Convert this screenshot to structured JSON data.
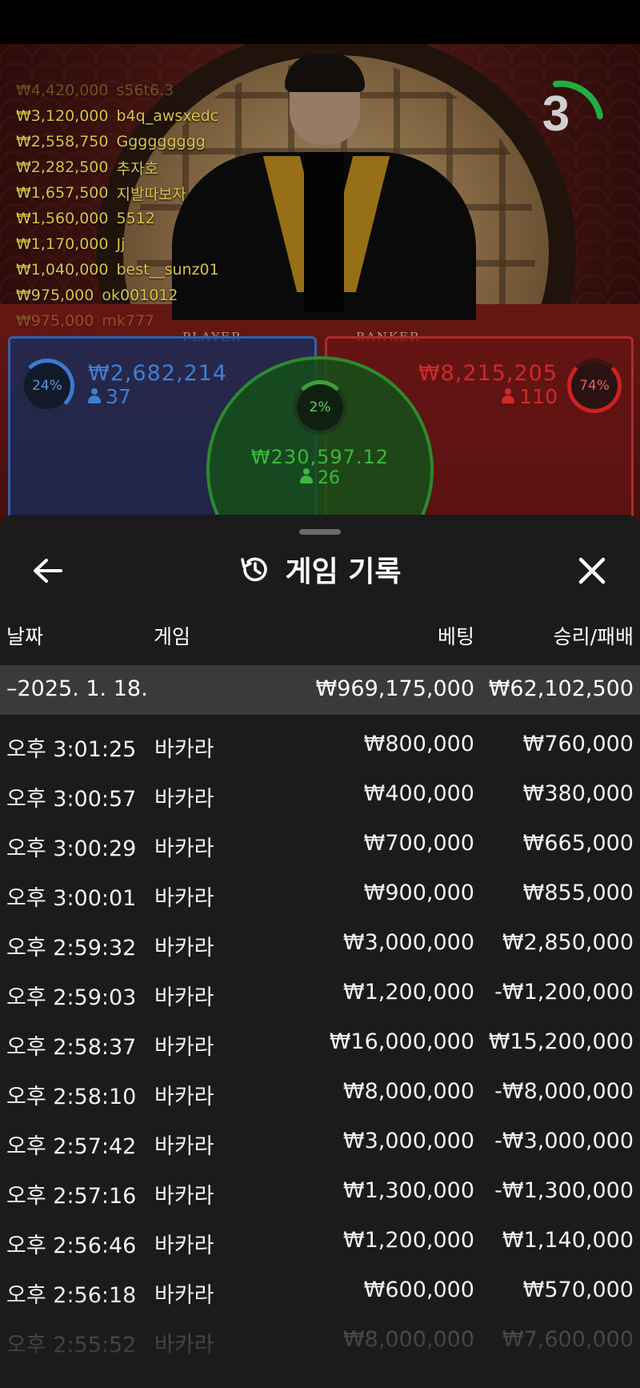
{
  "live": {
    "leaderboard": [
      {
        "amount": "₩4,420,000",
        "name": "s56t6.3",
        "faded": "top"
      },
      {
        "amount": "₩3,120,000",
        "name": "b4q_awsxedc"
      },
      {
        "amount": "₩2,558,750",
        "name": "Ggggggggg"
      },
      {
        "amount": "₩2,282,500",
        "name": "추자호"
      },
      {
        "amount": "₩1,657,500",
        "name": "지발따보자"
      },
      {
        "amount": "₩1,560,000",
        "name": "5512"
      },
      {
        "amount": "₩1,170,000",
        "name": "Jj"
      },
      {
        "amount": "₩1,040,000",
        "name": "best__sunz01"
      },
      {
        "amount": "₩975,000",
        "name": "ok001012"
      },
      {
        "amount": "₩975,000",
        "name": "mk777",
        "faded": "bottom"
      }
    ],
    "timer": "3",
    "table_labels": {
      "player": "PLAYER",
      "banker": "BANKER"
    },
    "player": {
      "percent": "24%",
      "amount": "₩2,682,214",
      "players": "37"
    },
    "banker": {
      "percent": "74%",
      "amount": "₩8,215,205",
      "players": "110"
    },
    "tie": {
      "percent": "2%",
      "amount": "₩230,597.12",
      "players": "26"
    },
    "colors": {
      "player": "#2f62b0",
      "banker": "#b02a2a",
      "tie": "#2d8a2d",
      "timer_arc": "#1fae3f",
      "leader_text": "#d8c34a"
    }
  },
  "history": {
    "title": "게임 기록",
    "icons": {
      "back": "arrow-left-icon",
      "title": "history-icon",
      "close": "close-icon"
    },
    "columns": {
      "date": "날짜",
      "game": "게임",
      "bet": "베팅",
      "win_loss": "승리/패배"
    },
    "summary": {
      "date": "–2025. 1. 18.",
      "bet": "₩969,175,000",
      "win_loss": "₩62,102,500"
    },
    "rows": [
      {
        "time": "오후 3:01:25",
        "game": "바카라",
        "bet": "₩800,000",
        "win_loss": "₩760,000"
      },
      {
        "time": "오후 3:00:57",
        "game": "바카라",
        "bet": "₩400,000",
        "win_loss": "₩380,000"
      },
      {
        "time": "오후 3:00:29",
        "game": "바카라",
        "bet": "₩700,000",
        "win_loss": "₩665,000"
      },
      {
        "time": "오후 3:00:01",
        "game": "바카라",
        "bet": "₩900,000",
        "win_loss": "₩855,000"
      },
      {
        "time": "오후 2:59:32",
        "game": "바카라",
        "bet": "₩3,000,000",
        "win_loss": "₩2,850,000"
      },
      {
        "time": "오후 2:59:03",
        "game": "바카라",
        "bet": "₩1,200,000",
        "win_loss": "-₩1,200,000"
      },
      {
        "time": "오후 2:58:37",
        "game": "바카라",
        "bet": "₩16,000,000",
        "win_loss": "₩15,200,000"
      },
      {
        "time": "오후 2:58:10",
        "game": "바카라",
        "bet": "₩8,000,000",
        "win_loss": "-₩8,000,000"
      },
      {
        "time": "오후 2:57:42",
        "game": "바카라",
        "bet": "₩3,000,000",
        "win_loss": "-₩3,000,000"
      },
      {
        "time": "오후 2:57:16",
        "game": "바카라",
        "bet": "₩1,300,000",
        "win_loss": "-₩1,300,000"
      },
      {
        "time": "오후 2:56:46",
        "game": "바카라",
        "bet": "₩1,200,000",
        "win_loss": "₩1,140,000"
      },
      {
        "time": "오후 2:56:18",
        "game": "바카라",
        "bet": "₩600,000",
        "win_loss": "₩570,000"
      },
      {
        "time": "오후 2:55:52",
        "game": "바카라",
        "bet": "₩8,000,000",
        "win_loss": "₩7,600,000",
        "faded": true
      }
    ],
    "colors": {
      "background": "#1b1b1b",
      "summary_row": "#3a3a3a",
      "text": "#ffffff"
    }
  }
}
